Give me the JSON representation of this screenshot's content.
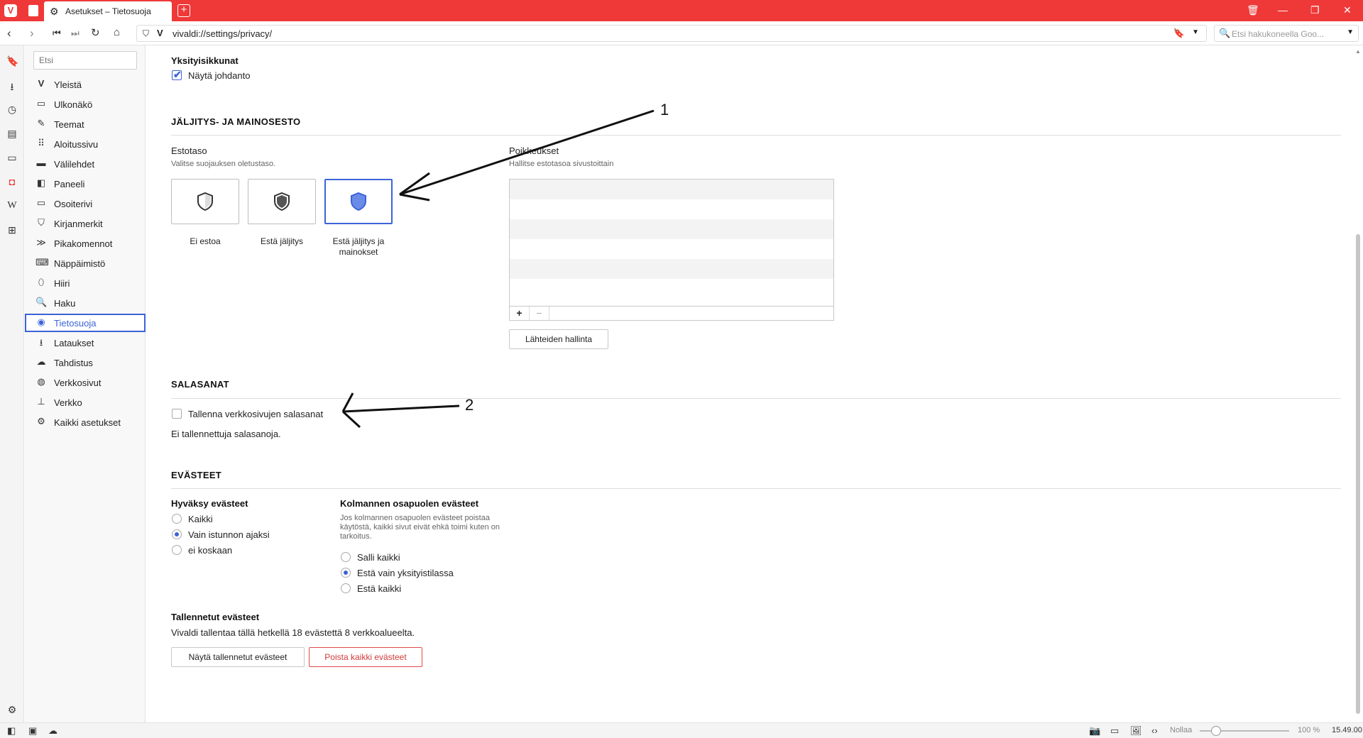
{
  "tab": {
    "title": "Asetukset – Tietosuoja"
  },
  "address": {
    "url": "vivaldi://settings/privacy/"
  },
  "search": {
    "placeholder": "Etsi hakukoneella Goo..."
  },
  "sidebar": {
    "filter_placeholder": "Etsi",
    "items": [
      {
        "label": "Yleistä",
        "icon": "vivaldi-v-icon"
      },
      {
        "label": "Ulkonäkö",
        "icon": "folder-icon"
      },
      {
        "label": "Teemat",
        "icon": "brush-icon"
      },
      {
        "label": "Aloitussivu",
        "icon": "grid-icon"
      },
      {
        "label": "Välilehdet",
        "icon": "tabs-icon"
      },
      {
        "label": "Paneeli",
        "icon": "panel-icon"
      },
      {
        "label": "Osoiterivi",
        "icon": "addressbar-icon"
      },
      {
        "label": "Kirjanmerkit",
        "icon": "bookmark-icon"
      },
      {
        "label": "Pikakomennot",
        "icon": "quick-commands-icon"
      },
      {
        "label": "Näppäimistö",
        "icon": "keyboard-icon"
      },
      {
        "label": "Hiiri",
        "icon": "mouse-icon"
      },
      {
        "label": "Haku",
        "icon": "search-icon"
      },
      {
        "label": "Tietosuoja",
        "icon": "eye-icon"
      },
      {
        "label": "Lataukset",
        "icon": "download-icon"
      },
      {
        "label": "Tahdistus",
        "icon": "cloud-icon"
      },
      {
        "label": "Verkkosivut",
        "icon": "globe-icon"
      },
      {
        "label": "Verkko",
        "icon": "network-icon"
      },
      {
        "label": "Kaikki asetukset",
        "icon": "gear-icon"
      }
    ],
    "active_index": 12
  },
  "private_windows": {
    "heading": "Yksityisikkunat",
    "show_intro_label": "Näytä johdanto",
    "show_intro_checked": true
  },
  "tracking": {
    "section_title": "JÄLJITYS- JA MAINOSESTO",
    "level_heading": "Estotaso",
    "level_sub": "Valitse suojauksen oletustaso.",
    "levels": [
      {
        "label": "Ei estoa",
        "selected": false
      },
      {
        "label": "Estä jäljitys",
        "selected": false
      },
      {
        "label": "Estä jäljitys ja mainokset",
        "selected": true
      }
    ],
    "exceptions_heading": "Poikkeukset",
    "exceptions_sub": "Hallitse estotasoa sivustoittain",
    "add_label": "+",
    "remove_label": "−",
    "manage_sources_label": "Lähteiden hallinta"
  },
  "passwords": {
    "section_title": "SALASANAT",
    "save_label": "Tallenna verkkosivujen salasanat",
    "save_checked": false,
    "none_saved": "Ei tallennettuja salasanoja."
  },
  "cookies": {
    "section_title": "EVÄSTEET",
    "accept_heading": "Hyväksy evästeet",
    "accept_options": [
      {
        "label": "Kaikki",
        "selected": false
      },
      {
        "label": "Vain istunnon ajaksi",
        "selected": true
      },
      {
        "label": "ei koskaan",
        "selected": false
      }
    ],
    "third_party_heading": "Kolmannen osapuolen evästeet",
    "third_party_desc": "Jos kolmannen osapuolen evästeet poistaa käytöstä, kaikki sivut eivät ehkä toimi kuten on tarkoitus.",
    "third_party_options": [
      {
        "label": "Salli kaikki",
        "selected": false
      },
      {
        "label": "Estä vain yksityistilassa",
        "selected": true
      },
      {
        "label": "Estä kaikki",
        "selected": false
      }
    ],
    "saved_heading": "Tallennetut evästeet",
    "saved_text": "Vivaldi tallentaa tällä hetkellä 18 evästettä 8 verkkoalueelta.",
    "show_button": "Näytä tallennetut evästeet",
    "delete_button": "Poista kaikki evästeet"
  },
  "annotations": {
    "one": "1",
    "two": "2"
  },
  "status": {
    "reset_label": "Nollaa",
    "zoom": "100 %",
    "zoom_fraction": 0.12,
    "time": "15.49.00"
  },
  "colors": {
    "accent": "#3c63d8",
    "brand": "#ef3939",
    "danger": "#d23a3a"
  }
}
